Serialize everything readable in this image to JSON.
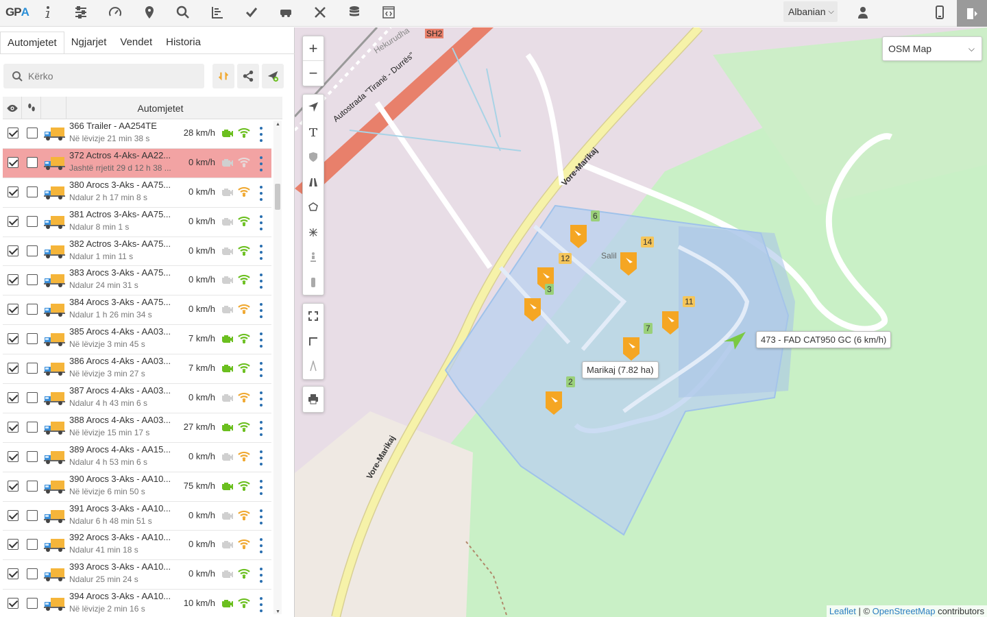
{
  "topbar": {
    "logo_main": "GP",
    "logo_accent": "A",
    "icons": [
      "info-icon",
      "sliders-icon",
      "speedometer-icon",
      "location-pin-icon",
      "search-icon",
      "chart-icon",
      "check-icon",
      "vehicle-icon",
      "tools-icon",
      "database-icon",
      "code-window-icon"
    ],
    "language": "Albanian"
  },
  "tabs": [
    "Automjetet",
    "Ngjarjet",
    "Vendet",
    "Historia"
  ],
  "search": {
    "placeholder": "Kërko"
  },
  "table": {
    "column_title": "Automjetet"
  },
  "vehicles": [
    {
      "name": "366 Trailer - AA254TE",
      "status": "Në lëvizje 21 min 38 s",
      "speed": "28 km/h",
      "engine_on": true,
      "signal": "good",
      "alert": false
    },
    {
      "name": "372 Actros 4-Aks- AA22...",
      "status": "Jashtë rrjetit 29 d 12 h 38 ...",
      "speed": "0 km/h",
      "engine_on": false,
      "signal": "none",
      "alert": true
    },
    {
      "name": "380 Arocs 3-Aks - AA75...",
      "status": "Ndalur 2 h 17 min 8 s",
      "speed": "0 km/h",
      "engine_on": false,
      "signal": "weak",
      "alert": false
    },
    {
      "name": "381 Actros 3-Aks- AA75...",
      "status": "Ndalur 8 min 1 s",
      "speed": "0 km/h",
      "engine_on": false,
      "signal": "good",
      "alert": false
    },
    {
      "name": "382 Actros 3-Aks- AA75...",
      "status": "Ndalur 1 min 11 s",
      "speed": "0 km/h",
      "engine_on": false,
      "signal": "good",
      "alert": false
    },
    {
      "name": "383 Arocs 3-Aks - AA75...",
      "status": "Ndalur 24 min 31 s",
      "speed": "0 km/h",
      "engine_on": false,
      "signal": "good",
      "alert": false
    },
    {
      "name": "384 Arocs 3-Aks - AA75...",
      "status": "Ndalur 1 h 26 min 34 s",
      "speed": "0 km/h",
      "engine_on": false,
      "signal": "weak",
      "alert": false
    },
    {
      "name": "385 Arocs 4-Aks - AA03...",
      "status": "Në lëvizje 3 min 45 s",
      "speed": "7 km/h",
      "engine_on": true,
      "signal": "good",
      "alert": false
    },
    {
      "name": "386 Arocs 4-Aks - AA03...",
      "status": "Në lëvizje 3 min 27 s",
      "speed": "7 km/h",
      "engine_on": true,
      "signal": "good",
      "alert": false
    },
    {
      "name": "387 Arocs 4-Aks - AA03...",
      "status": "Ndalur 4 h 43 min 6 s",
      "speed": "0 km/h",
      "engine_on": false,
      "signal": "weak",
      "alert": false
    },
    {
      "name": "388 Arocs 4-Aks - AA03...",
      "status": "Në lëvizje 15 min 17 s",
      "speed": "27 km/h",
      "engine_on": true,
      "signal": "good",
      "alert": false
    },
    {
      "name": "389 Arocs 4-Aks - AA15...",
      "status": "Ndalur 4 h 53 min 6 s",
      "speed": "0 km/h",
      "engine_on": false,
      "signal": "weak",
      "alert": false
    },
    {
      "name": "390 Arocs 3-Aks - AA10...",
      "status": "Në lëvizje 6 min 50 s",
      "speed": "75 km/h",
      "engine_on": true,
      "signal": "good",
      "alert": false
    },
    {
      "name": "391 Arocs 3-Aks - AA10...",
      "status": "Ndalur 6 h 48 min 51 s",
      "speed": "0 km/h",
      "engine_on": false,
      "signal": "weak",
      "alert": false
    },
    {
      "name": "392 Arocs 3-Aks - AA10...",
      "status": "Ndalur 41 min 18 s",
      "speed": "0 km/h",
      "engine_on": false,
      "signal": "weak",
      "alert": false
    },
    {
      "name": "393 Arocs 3-Aks - AA10...",
      "status": "Ndalur 25 min 24 s",
      "speed": "0 km/h",
      "engine_on": false,
      "signal": "good",
      "alert": false
    },
    {
      "name": "394 Arocs 3-Aks - AA10...",
      "status": "Në lëvizje 2 min 16 s",
      "speed": "10 km/h",
      "engine_on": true,
      "signal": "good",
      "alert": false
    }
  ],
  "map": {
    "layer": "OSM Map",
    "zoom_in": "+",
    "zoom_out": "−",
    "road_labels": {
      "sh2": "SH2",
      "hekurudha": "Hekurudha",
      "autostrada": "Autostrada \"Tiranë - Durrës\"",
      "vore1": "Vore-Marikaj",
      "vore2": "Vore-Marikaj",
      "sali": "Salil"
    },
    "cluster_badges": [
      "6",
      "14",
      "12",
      "3",
      "11",
      "7",
      "2"
    ],
    "tooltip_vehicle": "473 - FAD CAT950 GC (6 km/h)",
    "tooltip_zone": "Marikaj (7.82 ha)",
    "attribution_leaflet": "Leaflet",
    "attribution_sep": " | © ",
    "attribution_osm": "OpenStreetMap",
    "attribution_tail": " contributors"
  },
  "colors": {
    "alert_row": "#f2a3a3",
    "engine_on": "#6bbf1f",
    "signal_good": "#6bbf1f",
    "signal_weak": "#f0a830",
    "marker": "#f5a623",
    "zone_fill": "#bcd4f0",
    "vehicle_arrow": "#7ac943"
  }
}
